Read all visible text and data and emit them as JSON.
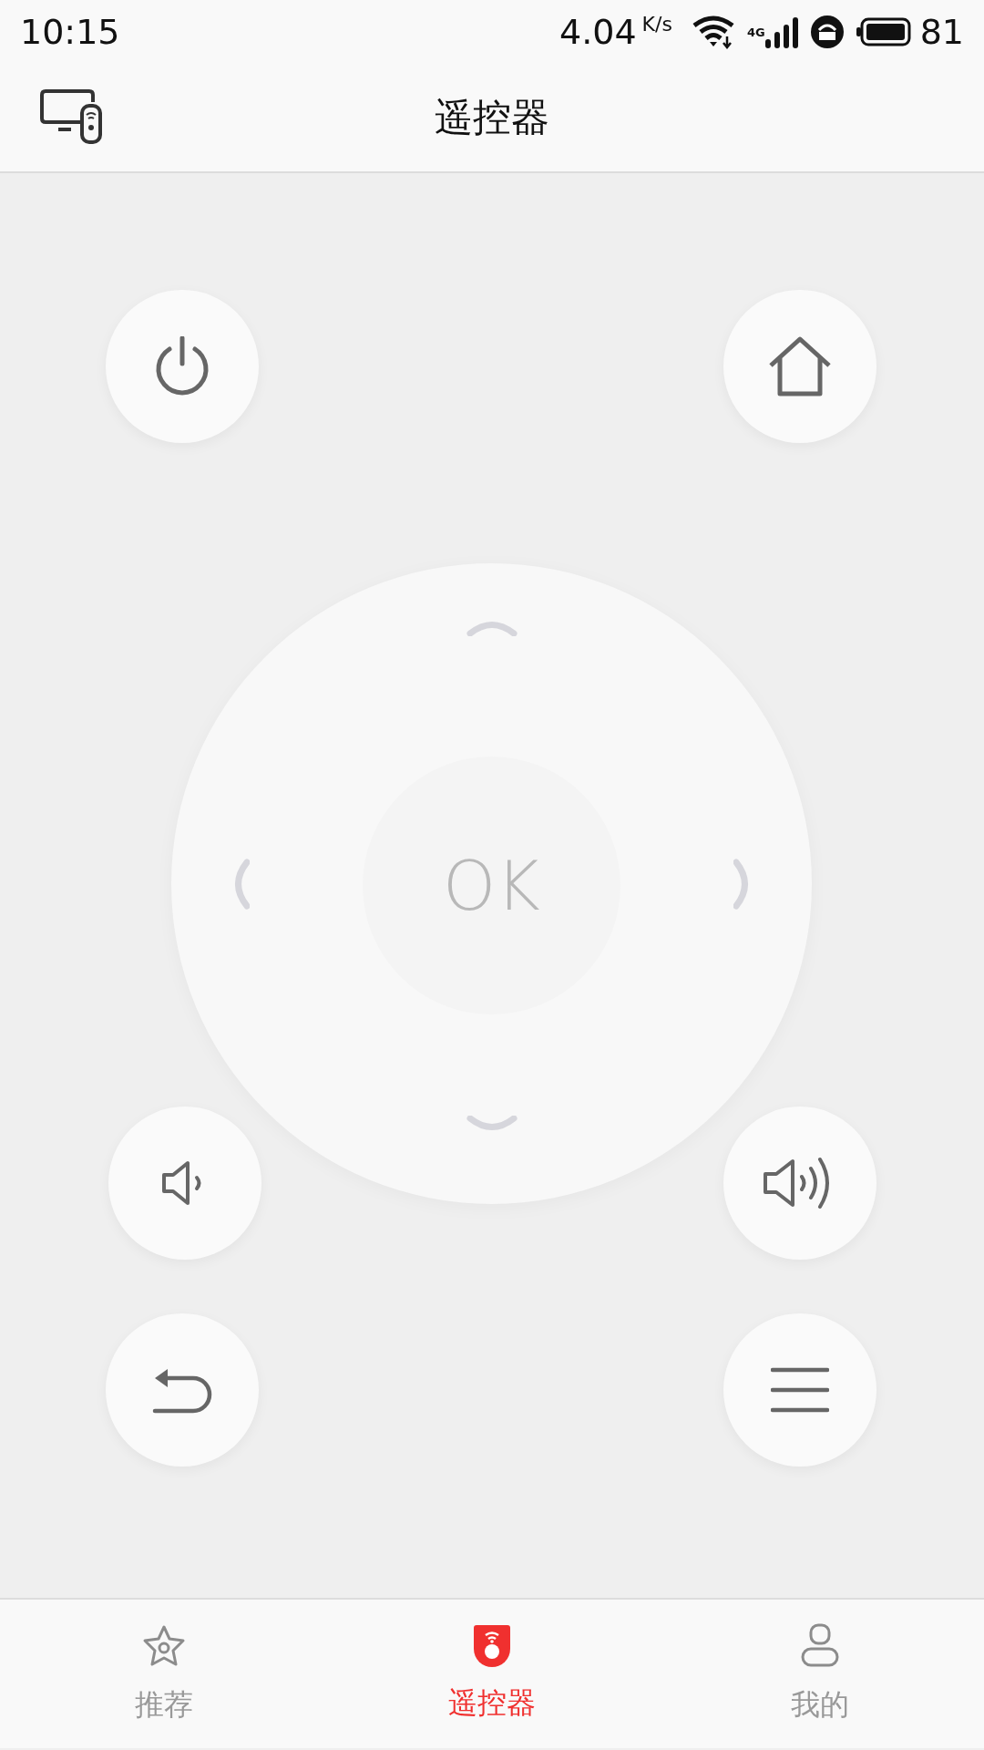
{
  "status_bar": {
    "time": "10:15",
    "speed": "4.04",
    "speed_unit": "K/s",
    "network": "4G",
    "battery": "81"
  },
  "header": {
    "title": "遥控器"
  },
  "remote": {
    "ok_label": "OK"
  },
  "nav": [
    {
      "label": "推荐",
      "selected": false
    },
    {
      "label": "遥控器",
      "selected": true
    },
    {
      "label": "我的",
      "selected": false
    }
  ]
}
